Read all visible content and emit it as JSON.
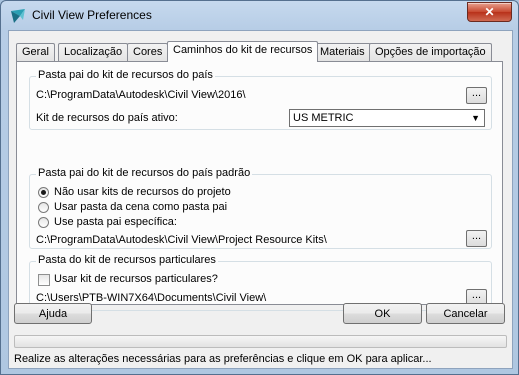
{
  "window": {
    "title": "Civil View Preferences",
    "close_glyph": "✕"
  },
  "tabs": [
    {
      "label": "Geral",
      "active": false
    },
    {
      "label": "Localização",
      "active": false
    },
    {
      "label": "Cores",
      "active": false
    },
    {
      "label": "Caminhos do kit de recursos",
      "active": true
    },
    {
      "label": "Materiais",
      "active": false
    },
    {
      "label": "Opções de importação",
      "active": false
    }
  ],
  "country_group": {
    "legend": "Pasta pai do kit de recursos do país",
    "path": "C:\\ProgramData\\Autodesk\\Civil View\\2016\\",
    "browse_label": "...",
    "active_kit_label": "Kit de recursos do país ativo:",
    "active_kit_value": "US METRIC"
  },
  "default_group": {
    "legend": "Pasta pai do kit de recursos do país padrão",
    "options": [
      {
        "label": "Não usar kits de recursos do projeto",
        "checked": true
      },
      {
        "label": "Usar pasta da cena como pasta pai",
        "checked": false
      },
      {
        "label": "Use pasta pai específica:",
        "checked": false
      }
    ],
    "path": "C:\\ProgramData\\Autodesk\\Civil View\\Project Resource Kits\\",
    "browse_label": "..."
  },
  "private_group": {
    "legend": "Pasta do kit de recursos particulares",
    "checkbox_label": "Usar kit de recursos particulares?",
    "checked": false,
    "path": "C:\\Users\\PTB-WIN7X64\\Documents\\Civil View\\",
    "browse_label": "..."
  },
  "buttons": {
    "help": "Ajuda",
    "ok": "OK",
    "cancel": "Cancelar"
  },
  "progress": 0,
  "status": "Realize as alterações necessárias para as preferências e clique em OK para aplicar..."
}
